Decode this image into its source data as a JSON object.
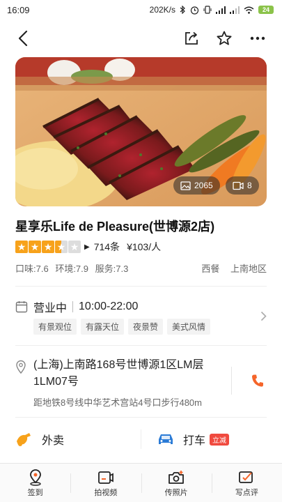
{
  "status_bar": {
    "time": "16:09",
    "net_speed": "202K/s",
    "battery": "24"
  },
  "nav": {
    "back_icon": "back-arrow-icon",
    "share_icon": "share-icon",
    "favorite_icon": "star-outline-icon",
    "more_icon": "more-icon"
  },
  "hero": {
    "photo_count": "2065",
    "video_count": "8"
  },
  "restaurant": {
    "name": "星享乐Life de Pleasure(世博源2店)",
    "rating_stars": 3.5,
    "review_count": "714条",
    "avg_price": "¥103/人",
    "scores": {
      "taste": "口味:7.6",
      "environment": "环境:7.9",
      "service": "服务:7.3"
    },
    "cuisine": "西餐",
    "district": "上南地区"
  },
  "hours": {
    "status": "营业中",
    "time": "10:00-22:00",
    "tags": [
      "有景观位",
      "有露天位",
      "夜景赞",
      "美式风情"
    ]
  },
  "address": {
    "line": "(上海)上南路168号世博源1区LM层1LM07号",
    "transit": "距地铁8号线中华艺术宫站4号口步行480m"
  },
  "services": {
    "takeout": "外卖",
    "taxi": "打车",
    "taxi_badge": "立减"
  },
  "bottom_tabs": [
    {
      "label": "签到",
      "icon": "checkin-icon"
    },
    {
      "label": "拍视频",
      "icon": "video-record-icon"
    },
    {
      "label": "传照片",
      "icon": "upload-photo-icon"
    },
    {
      "label": "写点评",
      "icon": "write-review-icon"
    }
  ],
  "colors": {
    "star": "#f7a21b",
    "star_empty": "#dddddd",
    "phone": "#f5652a",
    "takeout": "#f7a21b",
    "taxi": "#2b7bd6",
    "badge": "#f04a3f"
  }
}
